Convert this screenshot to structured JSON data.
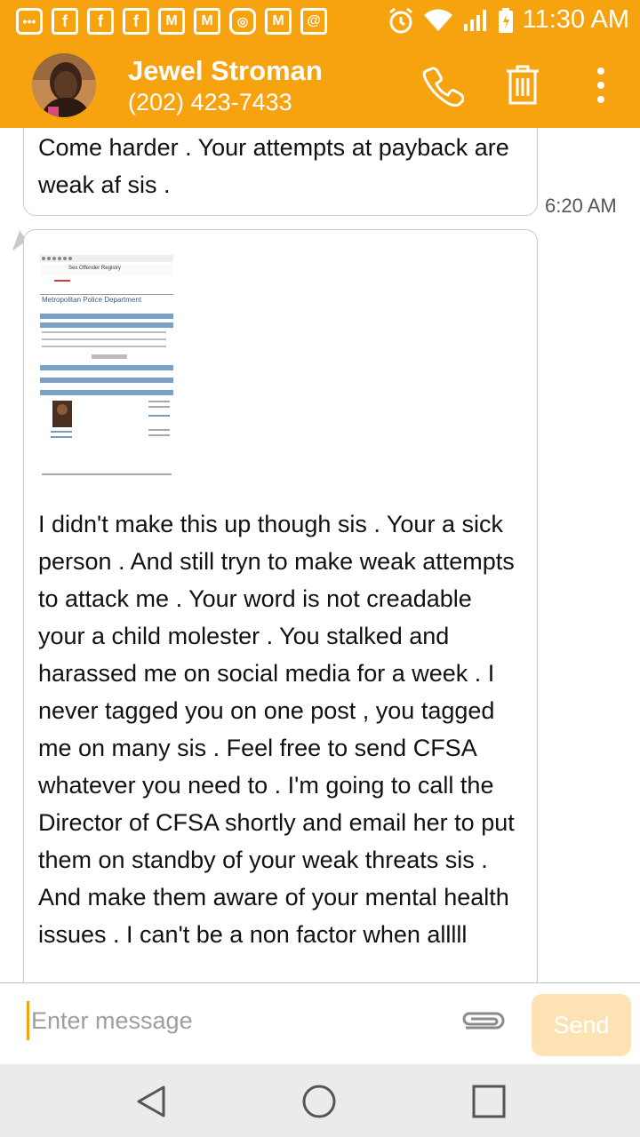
{
  "status_bar": {
    "time": "11:30 AM",
    "notification_icons": [
      "message-icon",
      "facebook-icon",
      "facebook-icon",
      "facebook-icon",
      "gmail-icon",
      "gmail-icon",
      "instagram-icon",
      "gmail-icon",
      "email-icon"
    ],
    "colors": {
      "bar": "#f7a20f"
    }
  },
  "header": {
    "contact_name": "Jewel Stroman",
    "contact_phone": "(202) 423-7433",
    "actions": [
      "phone-icon",
      "trash-icon",
      "more-vert-icon"
    ]
  },
  "messages": [
    {
      "text": "Come harder . Your attempts at payback are weak af sis .",
      "time": "6:20 AM"
    },
    {
      "attachment": {
        "title": "Sex Offender Registry",
        "org": "Metropolitan Police Department"
      },
      "text": "I didn't make this up though sis . Your a sick person . And still tryn to make weak attempts to attack me . Your word is not creadable your a child molester . You stalked and harassed me on social media for a week . I never tagged you on one post , you tagged me on many sis . Feel free to send CFSA whatever you need to . I'm going to call the Director of CFSA shortly and email her to put them on standby of your weak threats sis . And make them aware of your mental health issues . I can't be a non factor when alllll"
    }
  ],
  "composer": {
    "placeholder": "Enter message",
    "send_label": "Send"
  },
  "nav": [
    "back-icon",
    "home-icon",
    "recents-icon"
  ],
  "colors": {
    "accent": "#f7a20f",
    "send_disabled": "#fde3b3"
  }
}
